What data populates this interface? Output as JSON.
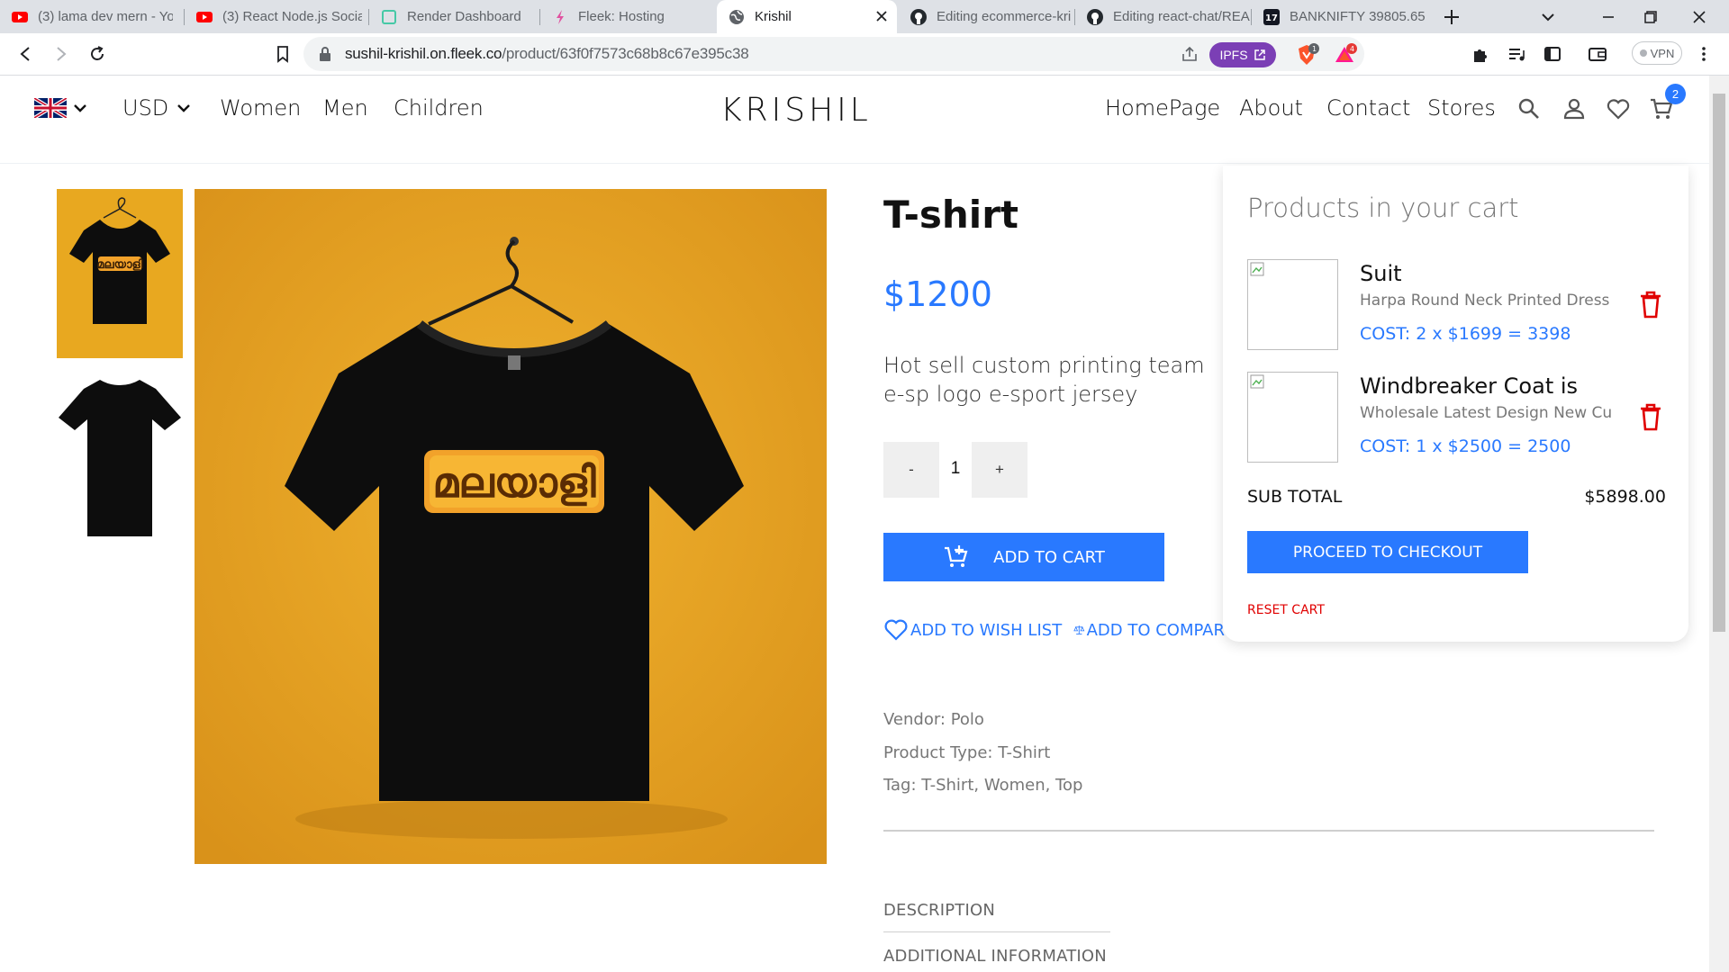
{
  "browser": {
    "tabs": [
      {
        "title": "(3) lama dev mern - Yo",
        "icon": "youtube-icon"
      },
      {
        "title": "(3) React Node.js Socia",
        "icon": "youtube-icon"
      },
      {
        "title": "Render Dashboard",
        "icon": "render-icon"
      },
      {
        "title": "Fleek: Hosting",
        "icon": "fleek-icon"
      },
      {
        "title": "Krishil",
        "icon": "globe-icon",
        "active": true
      },
      {
        "title": "Editing ecommerce-kri",
        "icon": "github-icon"
      },
      {
        "title": "Editing react-chat/REA",
        "icon": "github-icon"
      },
      {
        "title": "BANKNIFTY 39805.65 ▲",
        "icon": "tradingview-icon"
      }
    ],
    "url_host": "sushil-krishil.on.fleek.co",
    "url_path": "/product/63f0f7573c68b8c67e395c38",
    "ipfs_label": "IPFS",
    "vpn_label": "VPN",
    "brave_count": "1",
    "rewards_count": "4"
  },
  "header": {
    "currency": "USD",
    "nav_left": [
      "Women",
      "Men",
      "Children"
    ],
    "logo": "KRISHIL",
    "nav_right": [
      "HomePage",
      "About",
      "Contact",
      "Stores"
    ],
    "cart_count": "2"
  },
  "product": {
    "title": "T-shirt",
    "price": "$1200",
    "description": "Hot sell custom printing team e-sp logo e-sport jersey",
    "quantity": "1",
    "qty_minus": "-",
    "qty_plus": "+",
    "add_to_cart": "ADD TO CART",
    "wishlist": "ADD TO WISH LIST",
    "compare": "ADD TO COMPAR",
    "vendor": "Vendor: Polo",
    "product_type": "Product Type: T-Shirt",
    "tags": "Tag: T-Shirt, Women, Top",
    "tabs": [
      "DESCRIPTION",
      "ADDITIONAL INFORMATION"
    ],
    "shirt_print": "മലയാളി"
  },
  "cart": {
    "title": "Products in your cart",
    "items": [
      {
        "name": "Suit",
        "desc": "Harpa Round Neck Printed Dress",
        "cost": "COST: 2 x $1699 = 3398"
      },
      {
        "name": "Windbreaker Coat is",
        "desc": "Wholesale Latest Design New Cu",
        "cost": "COST: 1 x $2500 = 2500"
      }
    ],
    "subtotal_label": "SUB TOTAL",
    "subtotal_value": "$5898.00",
    "checkout": "PROCEED TO CHECKOUT",
    "reset": "RESET CART"
  },
  "colors": {
    "accent": "#2979ff",
    "danger": "#e00000",
    "product_bg": "#e8a820",
    "shirt": "#0d0d0d"
  }
}
